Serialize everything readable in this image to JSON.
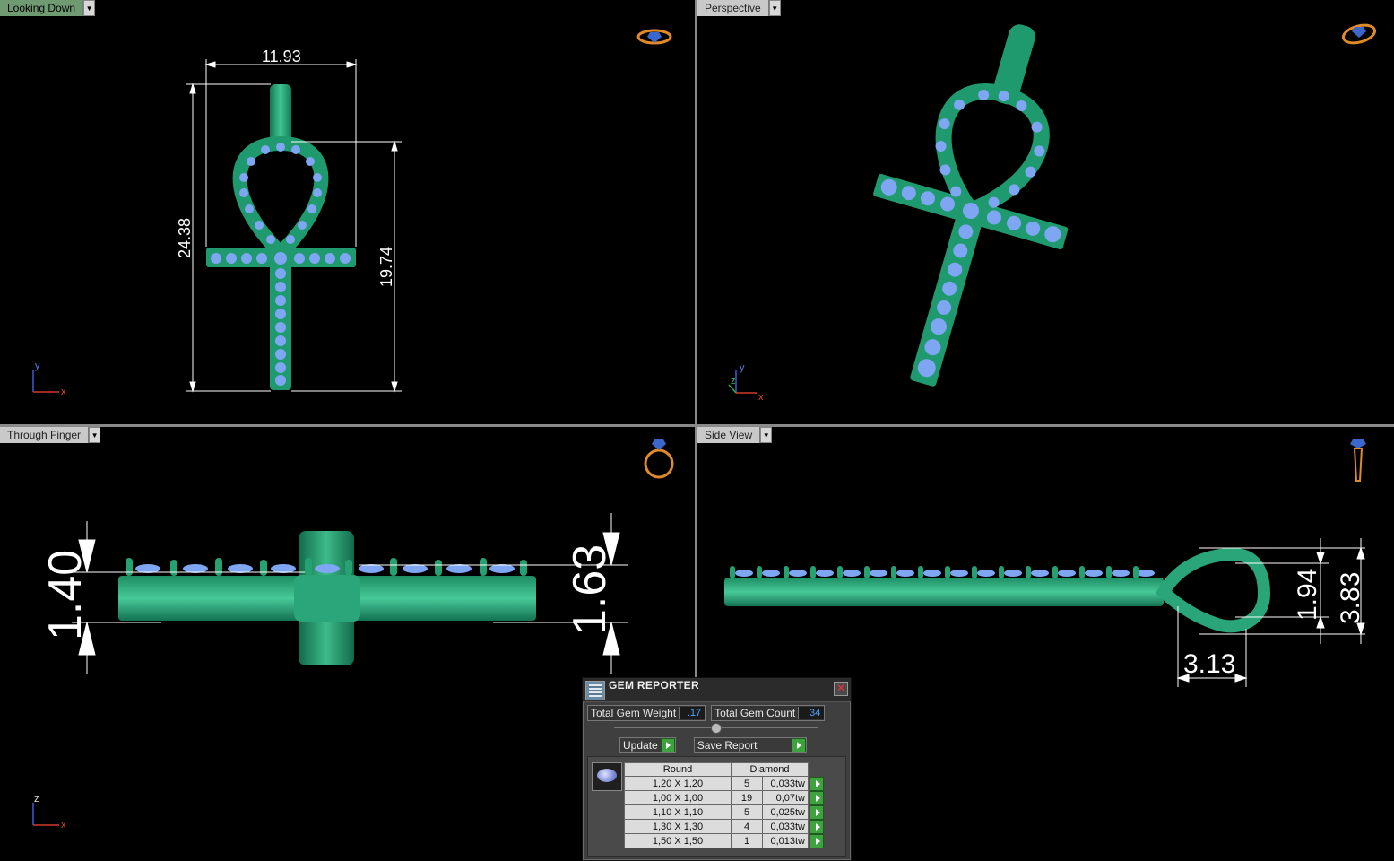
{
  "viewports": {
    "top_left": {
      "label": "Looking Down",
      "dims": {
        "width": "11.93",
        "height": "24.38",
        "lower": "19.74"
      },
      "axes": {
        "v": "y",
        "h": "x"
      }
    },
    "top_right": {
      "label": "Perspective",
      "axes": {
        "v": "y",
        "h": "x",
        "d": "z"
      }
    },
    "bottom_left": {
      "label": "Through Finger",
      "dims": {
        "left": "1.40",
        "right": "1.63"
      },
      "axes": {
        "v": "z",
        "h": "x"
      }
    },
    "bottom_right": {
      "label": "Side View",
      "dims": {
        "inner": "1.94",
        "outer": "3.83",
        "bottom": "3.13"
      }
    }
  },
  "gem_reporter": {
    "title": "GEM REPORTER",
    "total_weight_label": "Total Gem Weight",
    "total_weight_value": ".17",
    "total_count_label": "Total Gem Count",
    "total_count_value": "34",
    "update_label": "Update",
    "save_label": "Save Report",
    "table_headers": {
      "shape": "Round",
      "material": "Diamond"
    },
    "rows": [
      {
        "size": "1,20 X 1,20",
        "count": "5",
        "weight": "0,033tw"
      },
      {
        "size": "1,00 X 1,00",
        "count": "19",
        "weight": "0,07tw"
      },
      {
        "size": "1,10 X 1,10",
        "count": "5",
        "weight": "0,025tw"
      },
      {
        "size": "1,30 X 1,30",
        "count": "4",
        "weight": "0,033tw"
      },
      {
        "size": "1,50 X 1,50",
        "count": "1",
        "weight": "0,013tw"
      }
    ]
  },
  "colors": {
    "metal": "#1f9a6e",
    "metal_light": "#44c795",
    "gem": "#7fa6f2",
    "background": "#000000",
    "dims": "#ffffff"
  }
}
